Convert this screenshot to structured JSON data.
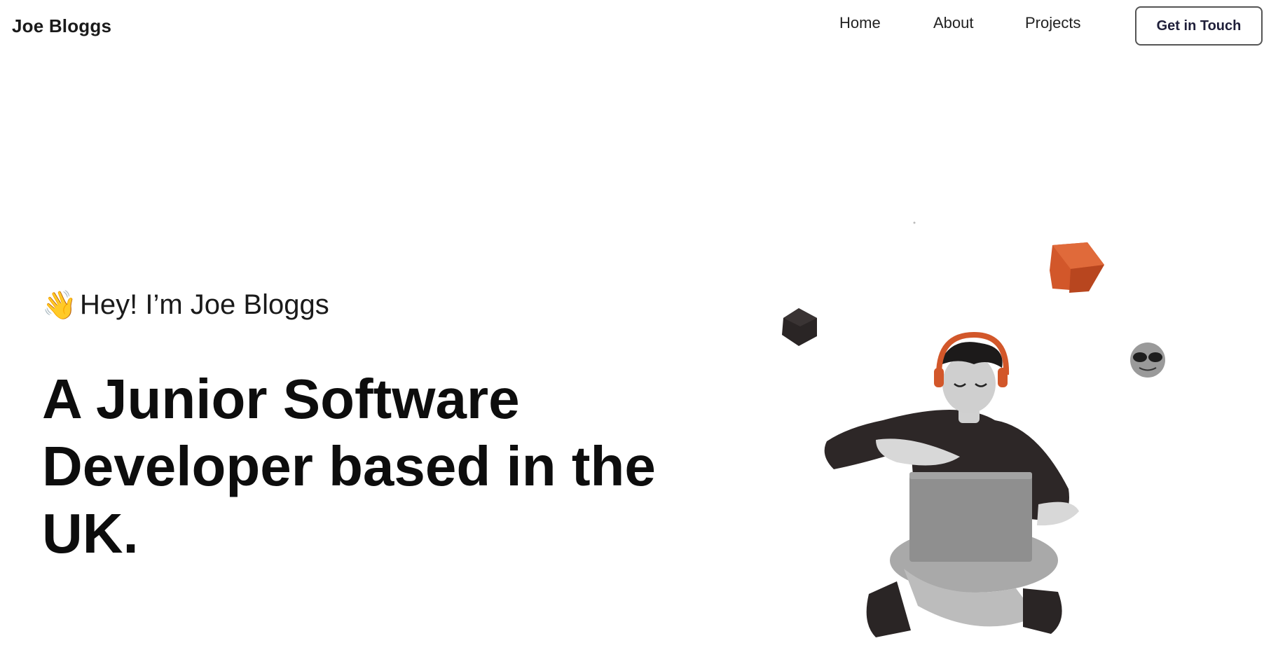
{
  "header": {
    "brand": "Joe Bloggs",
    "nav": [
      "Home",
      "About",
      "Projects"
    ],
    "cta_label": "Get in Touch"
  },
  "hero": {
    "wave_emoji": "👋",
    "greeting": "Hey! I’m Joe Bloggs",
    "headline": "A Junior Software Developer based in the UK."
  },
  "colors": {
    "accent_orange": "#d2572a",
    "dark": "#2a2525",
    "grey": "#8f8f8f"
  },
  "illustration": {
    "icon": "developer-with-laptop-illustration"
  }
}
